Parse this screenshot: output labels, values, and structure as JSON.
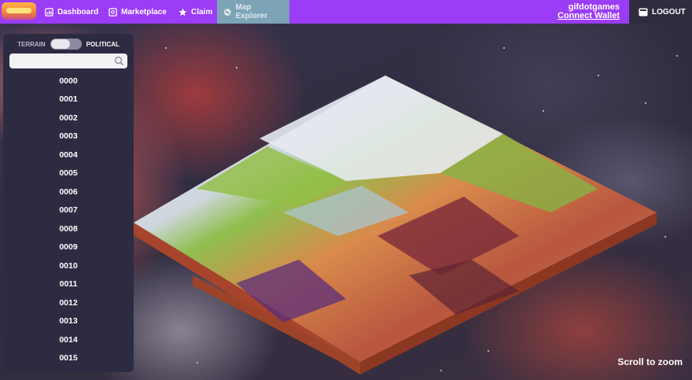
{
  "header": {
    "nav": [
      {
        "label": "Dashboard",
        "icon": "dashboard-icon"
      },
      {
        "label": "Marketplace",
        "icon": "marketplace-icon"
      },
      {
        "label": "Claim",
        "icon": "star-icon"
      },
      {
        "label": "Map Explorer",
        "icon": "globe-icon",
        "active": true
      }
    ],
    "username": "gifdotgames",
    "connect_wallet": "Connect Wallet",
    "logout": "LOGOUT"
  },
  "sidebar": {
    "toggle": {
      "left": "TERRAIN",
      "right": "POLITICAL",
      "selected": "TERRAIN"
    },
    "search": {
      "value": "",
      "placeholder": ""
    },
    "items": [
      "0000",
      "0001",
      "0002",
      "0003",
      "0004",
      "0005",
      "0006",
      "0007",
      "0008",
      "0009",
      "0010",
      "0011",
      "0012",
      "0013",
      "0014",
      "0015"
    ]
  },
  "map": {
    "hint": "Scroll to zoom"
  },
  "colors": {
    "nav_bg": "#9b3cf7",
    "nav_active": "#7ca3b6",
    "sidebar_bg": "#2d2b42",
    "page_bg": "#2f2c40"
  }
}
